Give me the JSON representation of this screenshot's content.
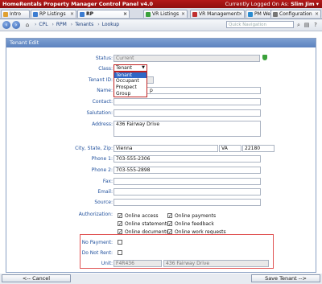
{
  "window": {
    "title": "HomeRentals Property Manager Control Panel v4.0",
    "logged_prefix": "Currently Logged On As:",
    "logged_user": "Slim Jim",
    "logged_suffix": "▾"
  },
  "tabs": [
    {
      "label": "Intro",
      "color": "#e0a030"
    },
    {
      "label": "RP Listings",
      "color": "#3b7cd1"
    },
    {
      "label": "RP Management",
      "color": "#3b7cd1"
    },
    {
      "label": "VR Listings",
      "color": "#3aa13a"
    },
    {
      "label": "VR Management",
      "color": "#c03030"
    },
    {
      "label": "PM Website",
      "color": "#2a8bd0"
    },
    {
      "label": "Configuration",
      "color": "#777777"
    }
  ],
  "breadcrumb": [
    "CPL",
    "RPM",
    "Tenants",
    "Lookup"
  ],
  "quick_nav": {
    "placeholder": "Quick Navigation"
  },
  "panel": {
    "title": "Tenant Edit"
  },
  "form": {
    "status": {
      "label": "Status:",
      "value": "Current"
    },
    "class": {
      "label": "Class:",
      "value": "Tenant",
      "options": [
        "Tenant",
        "Occupant",
        "Prospect",
        "Group"
      ]
    },
    "tenant_id": {
      "label": "Tenant ID:",
      "value": ""
    },
    "name": {
      "label": "Name:",
      "value": "p"
    },
    "contact": {
      "label": "Contact:",
      "value": ""
    },
    "salutation": {
      "label": "Salutation:",
      "value": ""
    },
    "address": {
      "label": "Address:",
      "value": "436 Fairway Drive"
    },
    "city_state_zip": {
      "label": "City, State, Zip:",
      "city": "Vienna",
      "state": "VA",
      "zip": "22180"
    },
    "phone1": {
      "label": "Phone 1:",
      "value": "703-555-2306"
    },
    "phone2": {
      "label": "Phone 2:",
      "value": "703-555-2898"
    },
    "fax": {
      "label": "Fax:",
      "value": ""
    },
    "email": {
      "label": "Email:",
      "value": ""
    },
    "source": {
      "label": "Source:",
      "value": ""
    },
    "authorization": {
      "label": "Authorization:",
      "items": [
        {
          "label": "Online access",
          "checked": true
        },
        {
          "label": "Online payments",
          "checked": true
        },
        {
          "label": "Online statements",
          "checked": true
        },
        {
          "label": "Online feedback",
          "checked": true
        },
        {
          "label": "Online documents",
          "checked": true
        },
        {
          "label": "Online work requests",
          "checked": true
        }
      ]
    },
    "no_payment": {
      "label": "No Payment:",
      "checked": false
    },
    "do_not_rent": {
      "label": "Do Not Rent:",
      "checked": false
    },
    "unit": {
      "label": "Unit:",
      "code": "F4R436",
      "address": "436 Fairway Drive"
    }
  },
  "buttons": {
    "cancel": "<-- Cancel",
    "save": "Save Tenant -->"
  }
}
